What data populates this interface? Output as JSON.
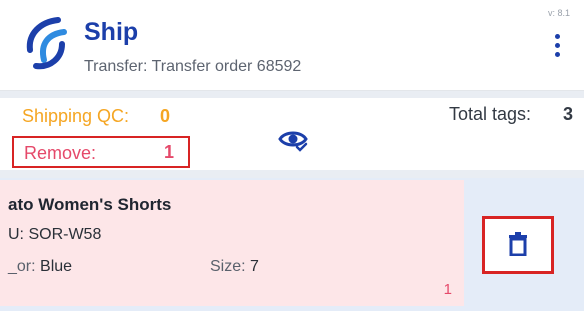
{
  "header": {
    "title": "Ship",
    "subtitle": "Transfer: Transfer order 68592",
    "version": "v: 8.1",
    "logo_icon": "ship-logo-icon",
    "menu_icon": "more-vertical-icon"
  },
  "summary": {
    "shipping_qc_label": "Shipping QC:",
    "shipping_qc_value": "0",
    "remove_label": "Remove:",
    "remove_value": "1",
    "view_icon": "eye-check-icon",
    "total_tags_label": "Total tags:",
    "total_tags_value": "3"
  },
  "item": {
    "name": "ato Women's Shorts",
    "sku_line": "U: SOR-W58",
    "color_label": "_or:",
    "color_value": "Blue",
    "size_label": "Size:",
    "size_value": "7",
    "quantity": "1",
    "delete_icon": "trash-icon"
  },
  "colors": {
    "brand_blue": "#1c3faa",
    "qc_orange": "#f5a623",
    "remove_pink": "#e5496a",
    "highlight_red": "#d82424",
    "card_pink": "#fde6e8"
  }
}
